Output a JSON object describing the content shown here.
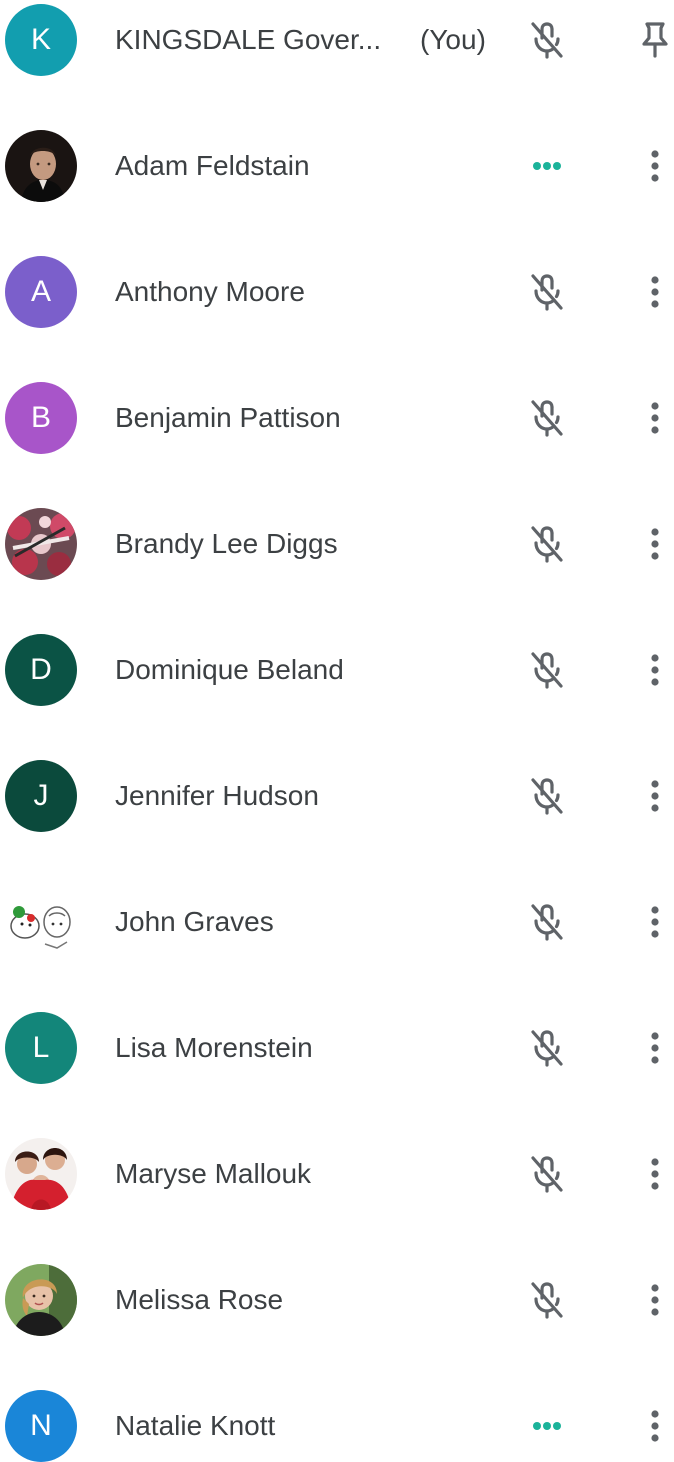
{
  "participants": [
    {
      "name": "KINGSDALE Gover...",
      "suffix": "(You)",
      "avatar_type": "letter",
      "initial": "K",
      "color": "#129eaf",
      "status": "mic-off-icon",
      "action": "pin-icon"
    },
    {
      "name": "Adam Feldstain",
      "avatar_type": "photo",
      "status": "speaking-dots-icon",
      "action": "more-vert-icon"
    },
    {
      "name": "Anthony Moore",
      "avatar_type": "letter",
      "initial": "A",
      "color": "#7b5fcb",
      "status": "mic-off-icon",
      "action": "more-vert-icon"
    },
    {
      "name": "Benjamin Pattison",
      "avatar_type": "letter",
      "initial": "B",
      "color": "#a855c9",
      "status": "mic-off-icon",
      "action": "more-vert-icon"
    },
    {
      "name": "Brandy Lee Diggs",
      "avatar_type": "photo",
      "status": "mic-off-icon",
      "action": "more-vert-icon"
    },
    {
      "name": "Dominique Beland",
      "avatar_type": "letter",
      "initial": "D",
      "color": "#0b5345",
      "status": "mic-off-icon",
      "action": "more-vert-icon"
    },
    {
      "name": "Jennifer Hudson",
      "avatar_type": "letter",
      "initial": "J",
      "color": "#0b4a3c",
      "status": "mic-off-icon",
      "action": "more-vert-icon"
    },
    {
      "name": "John Graves",
      "avatar_type": "photo",
      "status": "mic-off-icon",
      "action": "more-vert-icon"
    },
    {
      "name": "Lisa Morenstein",
      "avatar_type": "letter",
      "initial": "L",
      "color": "#13867a",
      "status": "mic-off-icon",
      "action": "more-vert-icon"
    },
    {
      "name": "Maryse Mallouk",
      "avatar_type": "photo",
      "status": "mic-off-icon",
      "action": "more-vert-icon"
    },
    {
      "name": "Melissa Rose",
      "avatar_type": "photo",
      "status": "mic-off-icon",
      "action": "more-vert-icon"
    },
    {
      "name": "Natalie Knott",
      "avatar_type": "letter",
      "initial": "N",
      "color": "#1a86d8",
      "status": "speaking-dots-icon",
      "action": "more-vert-icon"
    }
  ],
  "colors": {
    "text": "#3c4043",
    "icon": "#5f6368",
    "speaking": "#1bb39a"
  }
}
